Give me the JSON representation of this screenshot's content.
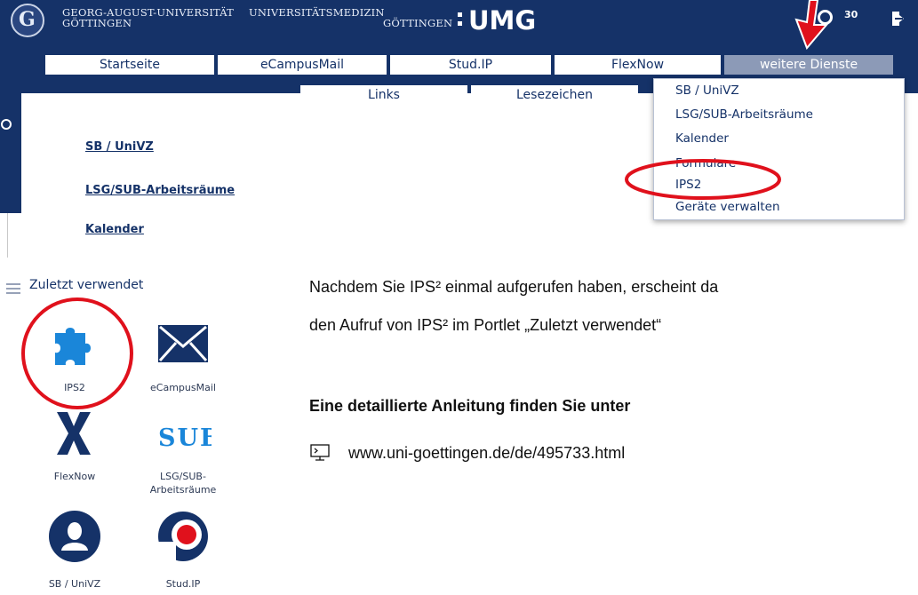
{
  "header": {
    "university_line1": "GEORG-AUGUST-UNIVERSITÄT",
    "university_line2": "GÖTTINGEN",
    "med_line1": "UNIVERSITÄTSMEDIZIN",
    "med_line2": "GÖTTINGEN",
    "umg": "UMG",
    "notification_count": "30"
  },
  "nav": {
    "tabs": [
      "Startseite",
      "eCampusMail",
      "Stud.IP",
      "FlexNow",
      "weitere Dienste"
    ],
    "subtabs": [
      "Links",
      "Lesezeichen"
    ]
  },
  "sidebar_links": [
    "SB / UniVZ",
    "LSG/SUB-Arbeitsräume",
    "Kalender"
  ],
  "dropdown": {
    "items": [
      "SB / UniVZ",
      "LSG/SUB-Arbeitsräume",
      "Kalender",
      "Formulare",
      "IPS2",
      "Geräte verwalten"
    ]
  },
  "portlet": {
    "title": "Zuletzt verwendet",
    "apps": [
      {
        "label": "IPS2",
        "icon": "puzzle-icon"
      },
      {
        "label": "eCampusMail",
        "icon": "envelope-icon"
      },
      {
        "label": "FlexNow",
        "icon": "flexnow-x-icon"
      },
      {
        "label": "LSG/SUB-",
        "label2": "Arbeitsräume",
        "icon": "sub-logo-icon"
      },
      {
        "label": "SB / UniVZ",
        "icon": "user-icon"
      },
      {
        "label": "Stud.IP",
        "icon": "studip-icon"
      }
    ]
  },
  "content": {
    "para_line1": "Nachdem Sie IPS² einmal aufgerufen haben, erscheint da",
    "para_line2": "den Aufruf von IPS² im Portlet „Zuletzt verwendet“",
    "heading": "Eine detaillierte Anleitung finden Sie unter",
    "url": "www.uni-goettingen.de/de/495733.html"
  },
  "colors": {
    "brand_navy": "#153268",
    "brand_blue": "#1a86d9",
    "highlight_red": "#e0111c",
    "tab_active": "#8c9ab7"
  }
}
